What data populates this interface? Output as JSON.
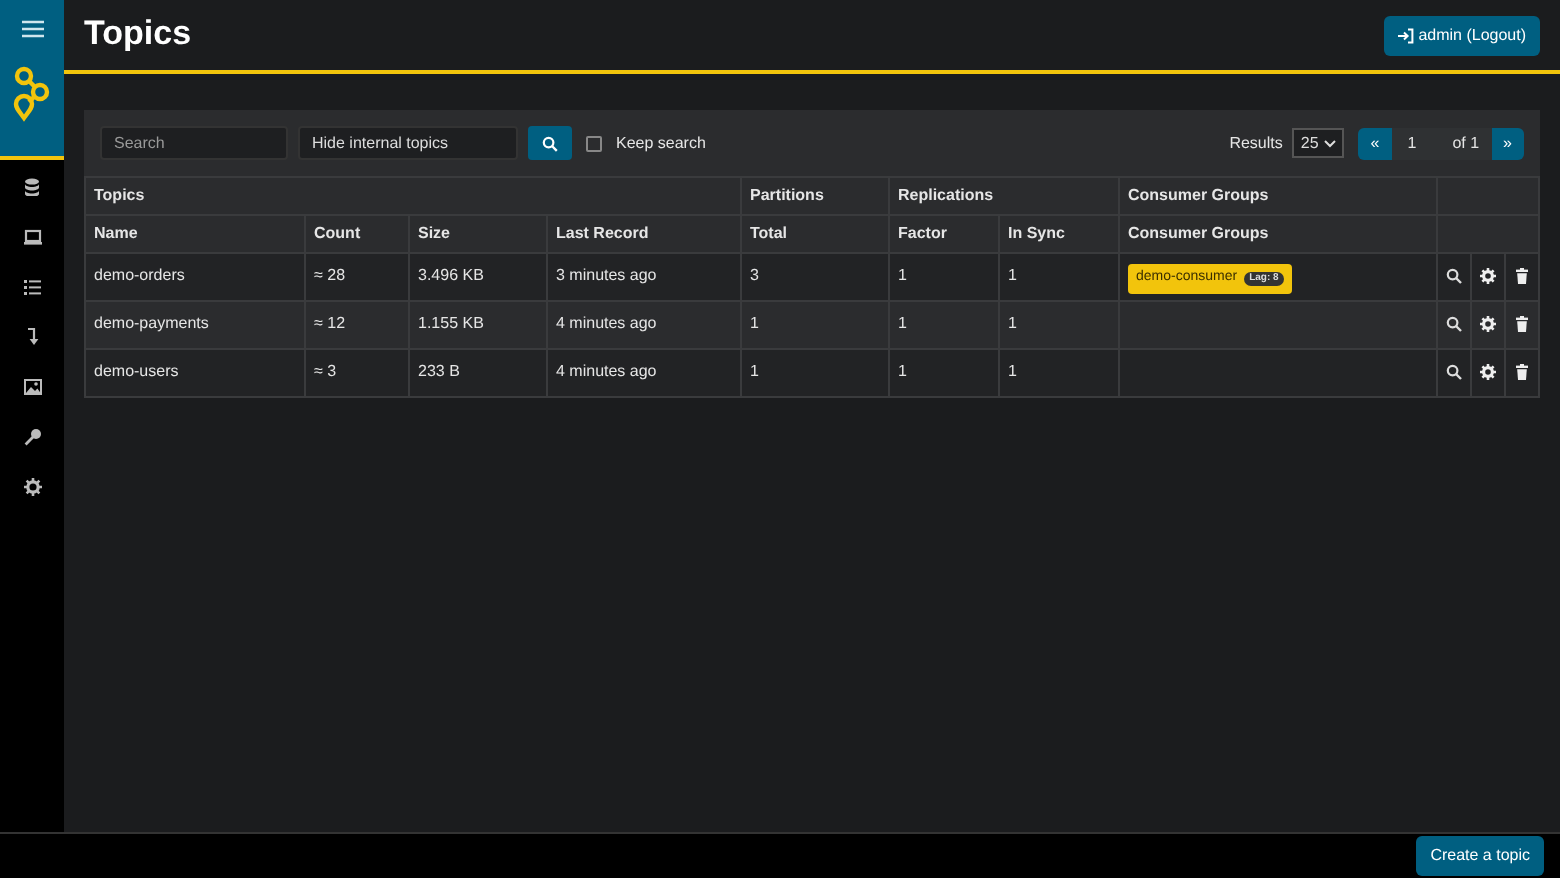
{
  "header": {
    "title": "Topics",
    "user_button": "admin (Logout)"
  },
  "sidebar": {
    "items": [
      {
        "kind": "database",
        "selected": false
      },
      {
        "kind": "laptop",
        "selected": false
      },
      {
        "kind": "list",
        "selected": false
      },
      {
        "kind": "download",
        "selected": false
      },
      {
        "kind": "image",
        "selected": false
      },
      {
        "kind": "key",
        "selected": false
      },
      {
        "kind": "gear",
        "selected": false
      }
    ]
  },
  "toolbar": {
    "search": {
      "placeholder": "Search"
    },
    "filter": {
      "value": "Hide internal topics"
    },
    "keep_search": {
      "label": "Keep search",
      "checked": false
    },
    "results_label": "Results",
    "page_size": "25",
    "pagination": {
      "prev": "«",
      "page": "1",
      "of": "of 1",
      "next": "»"
    }
  },
  "table": {
    "groups": [
      {
        "label": "Topics"
      },
      {
        "label": "Partitions"
      },
      {
        "label": "Replications"
      },
      {
        "label": "Consumer Groups"
      }
    ],
    "columns": [
      "Name",
      "Count",
      "Size",
      "Last Record",
      "Total",
      "Factor",
      "In Sync",
      "Consumer Groups"
    ],
    "rows": [
      {
        "cells": [
          "demo-orders",
          "≈ 28",
          "3.496 KB",
          "3 minutes ago",
          "3",
          "1",
          "1"
        ],
        "consumer_groups": [
          {
            "name": "demo-consumer",
            "lag": "Lag: 8"
          }
        ]
      },
      {
        "cells": [
          "demo-payments",
          "≈ 12",
          "1.155 KB",
          "4 minutes ago",
          "1",
          "1",
          "1"
        ],
        "consumer_groups": []
      },
      {
        "cells": [
          "demo-users",
          "≈ 3",
          "233 B",
          "4 minutes ago",
          "1",
          "1",
          "1"
        ],
        "consumer_groups": []
      }
    ]
  },
  "footer": {
    "create_button": "Create a topic"
  }
}
